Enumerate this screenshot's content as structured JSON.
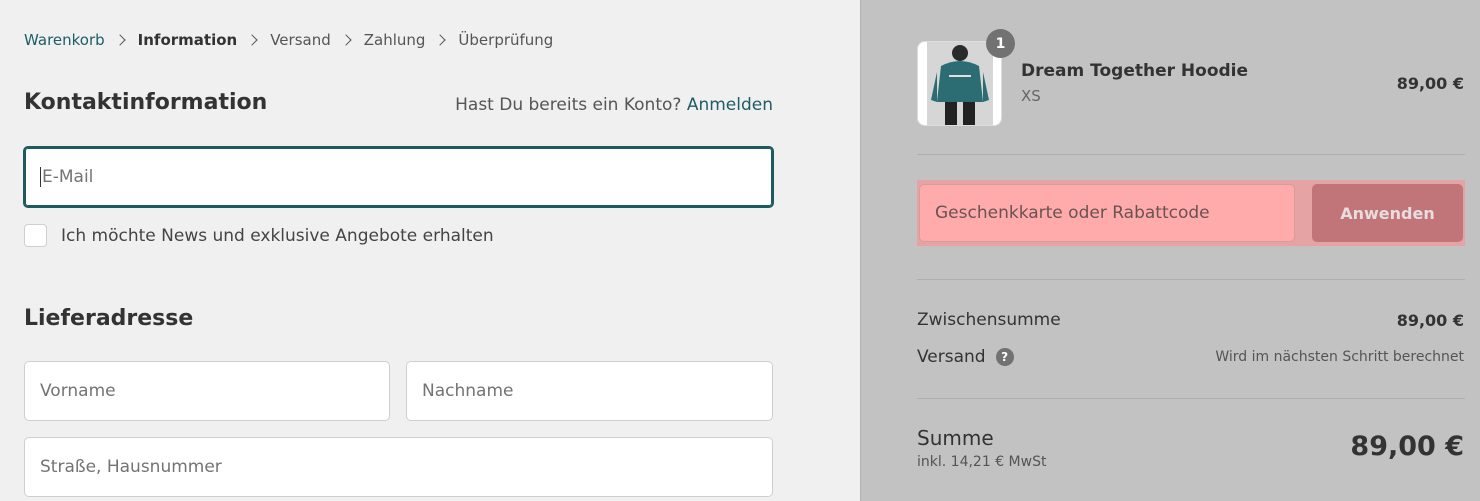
{
  "breadcrumb": {
    "items": [
      "Warenkorb",
      "Information",
      "Versand",
      "Zahlung",
      "Überprüfung"
    ]
  },
  "contact": {
    "title": "Kontaktinformation",
    "account_prompt": "Hast Du bereits ein Konto?",
    "login_link": "Anmelden",
    "email_placeholder": "E-Mail",
    "newsletter_label": "Ich möchte News und exklusive Angebote erhalten"
  },
  "shipping": {
    "title": "Lieferadresse",
    "first_name_placeholder": "Vorname",
    "last_name_placeholder": "Nachname",
    "street_placeholder": "Straße, Hausnummer"
  },
  "cart": {
    "item": {
      "quantity": "1",
      "name": "Dream Together Hoodie",
      "variant": "XS",
      "price": "89,00 €"
    },
    "discount": {
      "placeholder": "Geschenkkarte oder Rabattcode",
      "button_label": "Anwenden"
    },
    "subtotal_label": "Zwischensumme",
    "subtotal_value": "89,00 €",
    "shipping_label": "Versand",
    "shipping_help_icon": "?",
    "shipping_value": "Wird im nächsten Schritt berechnet",
    "total_label": "Summe",
    "tax_note": "inkl. 14,21 € MwSt",
    "total_value": "89,00 €"
  },
  "colors": {
    "accent": "#1b5e63",
    "right_panel_bg": "#c2c2c2",
    "discount_input_bg": "#ffabab",
    "apply_button_bg": "#c17579"
  }
}
